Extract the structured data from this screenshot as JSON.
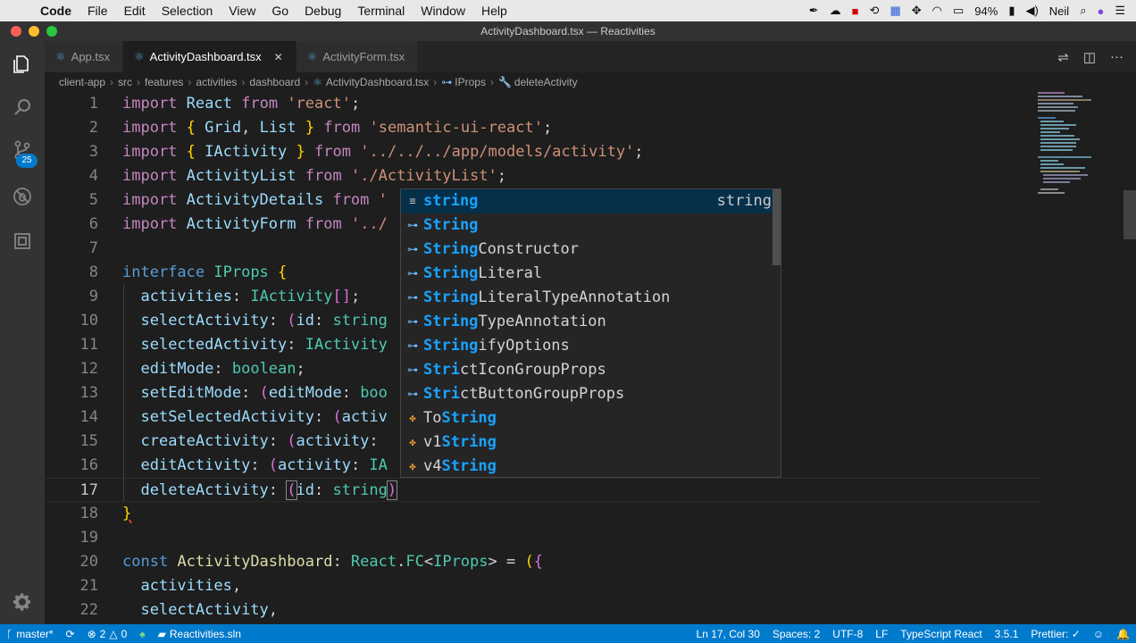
{
  "menubar": {
    "app": "Code",
    "items": [
      "File",
      "Edit",
      "Selection",
      "View",
      "Go",
      "Debug",
      "Terminal",
      "Window",
      "Help"
    ],
    "battery": "94%",
    "user": "Neil"
  },
  "window": {
    "title": "ActivityDashboard.tsx — Reactivities"
  },
  "tabs": [
    {
      "label": "App.tsx",
      "active": false
    },
    {
      "label": "ActivityDashboard.tsx",
      "active": true
    },
    {
      "label": "ActivityForm.tsx",
      "active": false
    }
  ],
  "breadcrumb": [
    "client-app",
    "src",
    "features",
    "activities",
    "dashboard",
    "ActivityDashboard.tsx",
    "IProps",
    "deleteActivity"
  ],
  "activitybar": {
    "scm_badge": "25"
  },
  "editor": {
    "line_numbers": [
      "1",
      "2",
      "3",
      "4",
      "5",
      "6",
      "7",
      "8",
      "9",
      "10",
      "11",
      "12",
      "13",
      "14",
      "15",
      "16",
      "17",
      "18",
      "19",
      "20",
      "21",
      "22"
    ],
    "current_line": 17
  },
  "suggest": {
    "items": [
      {
        "pre": "",
        "hl": "string",
        "post": "",
        "kind": "word",
        "detail": "string"
      },
      {
        "pre": "",
        "hl": "String",
        "post": "",
        "kind": "iface",
        "detail": ""
      },
      {
        "pre": "",
        "hl": "String",
        "post": "Constructor",
        "kind": "iface",
        "detail": ""
      },
      {
        "pre": "",
        "hl": "String",
        "post": "Literal",
        "kind": "iface",
        "detail": ""
      },
      {
        "pre": "",
        "hl": "String",
        "post": "LiteralTypeAnnotation",
        "kind": "iface",
        "detail": ""
      },
      {
        "pre": "",
        "hl": "String",
        "post": "TypeAnnotation",
        "kind": "iface",
        "detail": ""
      },
      {
        "pre": "",
        "hl": "String",
        "post": "ifyOptions",
        "kind": "iface",
        "detail": ""
      },
      {
        "pre": "",
        "hl": "Stri",
        "post": "ctIconGroupProps",
        "kind": "iface",
        "detail": ""
      },
      {
        "pre": "",
        "hl": "Stri",
        "post": "ctButtonGroupProps",
        "kind": "iface",
        "detail": ""
      },
      {
        "pre": "To",
        "hl": "String",
        "post": "",
        "kind": "fn",
        "detail": ""
      },
      {
        "pre": "v1",
        "hl": "String",
        "post": "",
        "kind": "fn",
        "detail": ""
      },
      {
        "pre": "v4",
        "hl": "String",
        "post": "",
        "kind": "fn",
        "detail": ""
      }
    ]
  },
  "statusbar": {
    "branch": "master*",
    "errors": "2",
    "warnings": "0",
    "solution": "Reactivities.sln",
    "position": "Ln 17, Col 30",
    "spaces": "Spaces: 2",
    "encoding": "UTF-8",
    "eol": "LF",
    "language": "TypeScript React",
    "version": "3.5.1",
    "prettier": "Prettier: ✓"
  }
}
